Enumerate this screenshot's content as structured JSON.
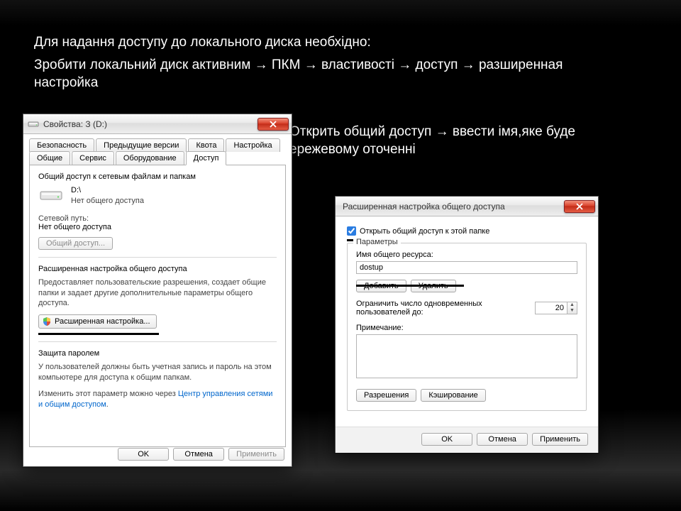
{
  "slide": {
    "caption1": "Для надання доступу до локального диска необхідно:",
    "caption2": "Зробити локальний диск активним → ПКМ → властивості → доступ → разширенная настройка",
    "caption3": "Открить общий доступ → ввести імя,яке буде ережевому оточенні"
  },
  "propsDialog": {
    "title": "Свойства: З (D:)",
    "tabs_row1": [
      "Безопасность",
      "Предыдущие версии",
      "Квота",
      "Настройка"
    ],
    "tabs_row2": [
      "Общие",
      "Сервис",
      "Оборудование",
      "Доступ"
    ],
    "activeTab": "Доступ",
    "share_section_title": "Общий доступ к сетевым файлам и папкам",
    "drive_label": "D:\\",
    "drive_status": "Нет общего доступа",
    "netpath_label": "Сетевой путь:",
    "netpath_value": "Нет общего доступа",
    "share_btn": "Общий доступ...",
    "adv_section_title": "Расширенная настройка общего доступа",
    "adv_para": "Предоставляет пользовательские разрешения, создает общие папки и задает другие дополнительные параметры общего доступа.",
    "adv_btn": "Расширенная настройка...",
    "pw_section_title": "Защита паролем",
    "pw_para1": "У пользователей должны быть учетная запись и пароль на этом компьютере для доступа к общим папкам.",
    "pw_para2_prefix": "Изменить этот параметр можно через ",
    "pw_link": "Центр управления сетями и общим доступом",
    "pw_link_suffix": ".",
    "ok": "OK",
    "cancel": "Отмена",
    "apply": "Применить"
  },
  "advDialog": {
    "title": "Расширенная настройка общего доступа",
    "checkbox_label": "Открыть общий доступ к этой папке",
    "checkbox_checked": true,
    "group_title": "Параметры",
    "name_label": "Имя общего ресурса:",
    "name_value": "dostup",
    "add_btn": "Добавить",
    "del_btn": "Удалить",
    "limit_label": "Ограничить число одновременных пользователей до:",
    "limit_value": "20",
    "note_label": "Примечание:",
    "note_value": "",
    "perm_btn": "Разрешения",
    "cache_btn": "Кэширование",
    "ok": "OK",
    "cancel": "Отмена",
    "apply": "Применить"
  }
}
